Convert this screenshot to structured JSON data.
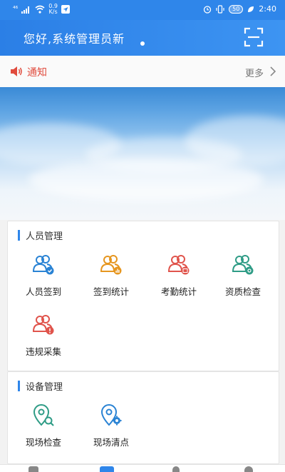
{
  "status_bar": {
    "signal": "⁴⁶",
    "speed_value": "0.9",
    "speed_unit": "K/s",
    "battery_level": "50",
    "time": "2:40"
  },
  "header": {
    "greeting": "您好,系统管理员新"
  },
  "notice": {
    "label": "通知",
    "more": "更多"
  },
  "sections": {
    "personnel": {
      "title": "人员管理",
      "items": [
        {
          "label": "人员签到",
          "icon": "user-check-icon",
          "color": "#2a83d4"
        },
        {
          "label": "签到统计",
          "icon": "user-stats-icon",
          "color": "#e6961f"
        },
        {
          "label": "考勤统计",
          "icon": "user-attendance-icon",
          "color": "#e0544c"
        },
        {
          "label": "资质检查",
          "icon": "user-qualification-icon",
          "color": "#2f9c86"
        },
        {
          "label": "违规采集",
          "icon": "user-violation-icon",
          "color": "#e0544c"
        }
      ]
    },
    "equipment": {
      "title": "设备管理",
      "items": [
        {
          "label": "现场检查",
          "icon": "site-inspect-icon",
          "color": "#2f9c86"
        },
        {
          "label": "现场清点",
          "icon": "site-inventory-icon",
          "color": "#2a83d4"
        }
      ]
    }
  },
  "colors": {
    "primary": "#2f86ea",
    "notice_red": "#e04b3d"
  }
}
